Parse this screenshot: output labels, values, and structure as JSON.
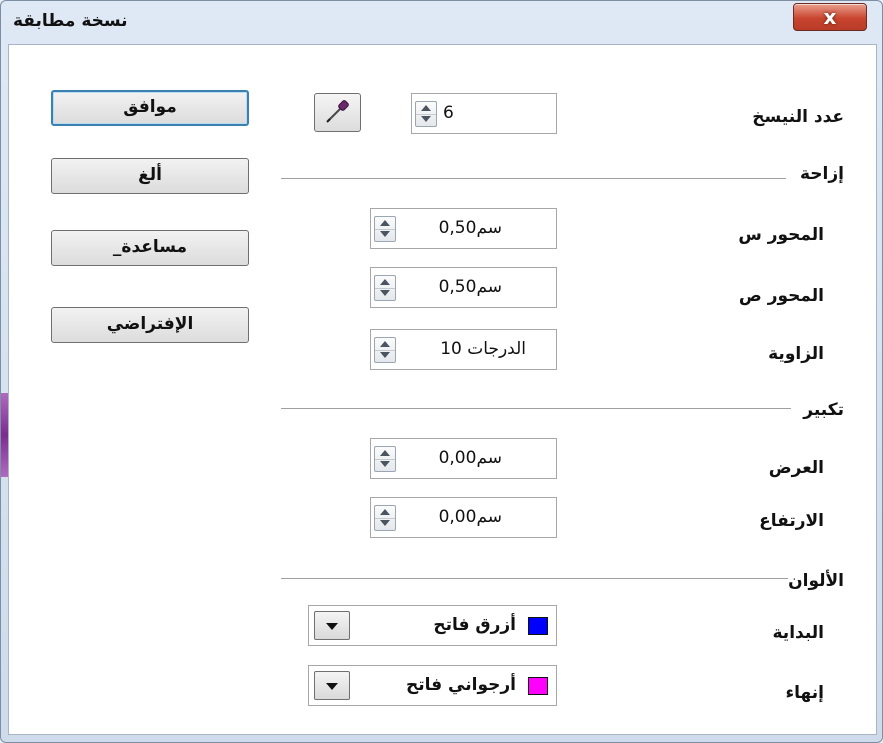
{
  "window": {
    "title": "نسخة مطابقة",
    "close_label": "x"
  },
  "buttons": {
    "ok": "موافق",
    "cancel": "ألغ",
    "help": "_مساعدة",
    "default": "الإفتراضي"
  },
  "copies": {
    "label": "عدد النيسخ",
    "value": "6"
  },
  "sections": {
    "placement": "إزاحة",
    "enlargement": "تكبير",
    "colors": "الألوان"
  },
  "placement": {
    "x_axis": {
      "label": "المحور س",
      "value": "0,50سم"
    },
    "y_axis": {
      "label": "المحور ص",
      "value": "0,50سم"
    },
    "angle": {
      "label": "الزاوية",
      "value": "الدرجات 10"
    }
  },
  "enlargement": {
    "width": {
      "label": "العرض",
      "value": "0,00سم"
    },
    "height": {
      "label": "الارتفاع",
      "value": "0,00سم"
    }
  },
  "colors": {
    "start": {
      "label": "البداية",
      "value": "أزرق فاتح",
      "swatch": "#0000ff"
    },
    "end": {
      "label": "إنهاء",
      "value": "أرجواني فاتح",
      "swatch": "#ff00ff"
    }
  },
  "icons": {
    "picker": "eyedropper-icon"
  }
}
